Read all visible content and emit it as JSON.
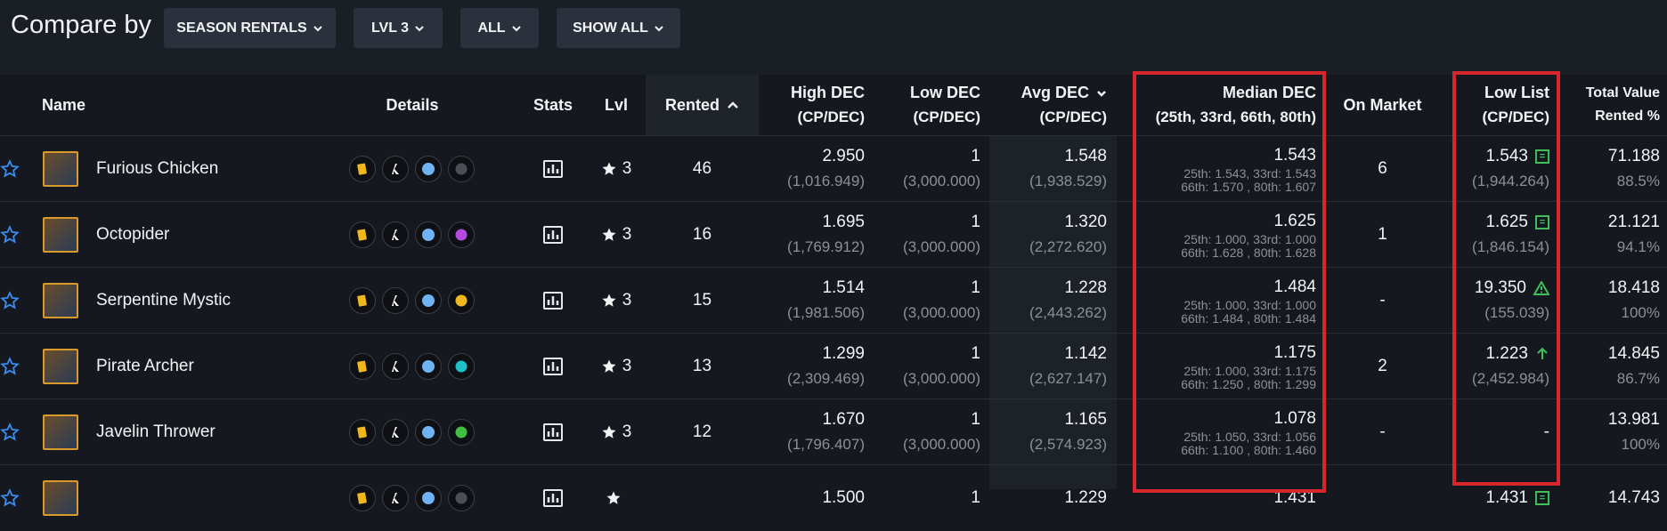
{
  "header": {
    "title": "Compare by",
    "filters": [
      "SEASON RENTALS",
      "LVL 3",
      "ALL",
      "SHOW ALL"
    ]
  },
  "columns": {
    "name": "Name",
    "details": "Details",
    "stats": "Stats",
    "lvl": "Lvl",
    "rented": "Rented",
    "high": [
      "High DEC",
      "(CP/DEC)"
    ],
    "low": [
      "Low DEC",
      "(CP/DEC)"
    ],
    "avg": [
      "Avg DEC",
      "(CP/DEC)"
    ],
    "median": [
      "Median DEC",
      "(25th, 33rd, 66th, 80th)"
    ],
    "on_market": "On Market",
    "low_list": [
      "Low List",
      "(CP/DEC)"
    ],
    "total": [
      "Total Value",
      "Rented %"
    ]
  },
  "rows": [
    {
      "name": "Furious Chicken",
      "lvl": "3",
      "rented": "46",
      "high": "2.950",
      "high_cp": "(1,016.949)",
      "low": "1",
      "low_cp": "(3,000.000)",
      "avg": "1.548",
      "avg_cp": "(1,938.529)",
      "median": "1.543",
      "median_l1": "25th: 1.543, 33rd: 1.543",
      "median_l2": "66th: 1.570 , 80th: 1.607",
      "on_market": "6",
      "low_list": "1.543",
      "low_list_cp": "(1,944.264)",
      "low_list_icon": "equal-icon",
      "total": "71.188",
      "pct": "88.5%",
      "element_color": "#4a4f58"
    },
    {
      "name": "Octopider",
      "lvl": "3",
      "rented": "16",
      "high": "1.695",
      "high_cp": "(1,769.912)",
      "low": "1",
      "low_cp": "(3,000.000)",
      "avg": "1.320",
      "avg_cp": "(2,272.620)",
      "median": "1.625",
      "median_l1": "25th: 1.000, 33rd: 1.000",
      "median_l2": "66th: 1.628 , 80th: 1.628",
      "on_market": "1",
      "low_list": "1.625",
      "low_list_cp": "(1,846.154)",
      "low_list_icon": "equal-icon",
      "total": "21.121",
      "pct": "94.1%",
      "element_color": "#b44be0"
    },
    {
      "name": "Serpentine Mystic",
      "lvl": "3",
      "rented": "15",
      "high": "1.514",
      "high_cp": "(1,981.506)",
      "low": "1",
      "low_cp": "(3,000.000)",
      "avg": "1.228",
      "avg_cp": "(2,443.262)",
      "median": "1.484",
      "median_l1": "25th: 1.000, 33rd: 1.000",
      "median_l2": "66th: 1.484 , 80th: 1.484",
      "on_market": "-",
      "low_list": "19.350",
      "low_list_cp": "(155.039)",
      "low_list_icon": "warning-icon",
      "total": "18.418",
      "pct": "100%",
      "element_color": "#f0b81c"
    },
    {
      "name": "Pirate Archer",
      "lvl": "3",
      "rented": "13",
      "high": "1.299",
      "high_cp": "(2,309.469)",
      "low": "1",
      "low_cp": "(3,000.000)",
      "avg": "1.142",
      "avg_cp": "(2,627.147)",
      "median": "1.175",
      "median_l1": "25th: 1.000, 33rd: 1.175",
      "median_l2": "66th: 1.250 , 80th: 1.299",
      "on_market": "2",
      "low_list": "1.223",
      "low_list_cp": "(2,452.984)",
      "low_list_icon": "arrow-up-icon",
      "total": "14.845",
      "pct": "86.7%",
      "element_color": "#1ec0c9"
    },
    {
      "name": "Javelin Thrower",
      "lvl": "3",
      "rented": "12",
      "high": "1.670",
      "high_cp": "(1,796.407)",
      "low": "1",
      "low_cp": "(3,000.000)",
      "avg": "1.165",
      "avg_cp": "(2,574.923)",
      "median": "1.078",
      "median_l1": "25th: 1.050, 33rd: 1.056",
      "median_l2": "66th: 1.100 , 80th: 1.460",
      "on_market": "-",
      "low_list": "-",
      "low_list_cp": "",
      "low_list_icon": "",
      "total": "13.981",
      "pct": "100%",
      "element_color": "#3fbf3f"
    },
    {
      "name": "",
      "lvl": "",
      "rented": "",
      "high": "1.500",
      "high_cp": "",
      "low": "1",
      "low_cp": "",
      "avg": "1.229",
      "avg_cp": "",
      "median": "1.431",
      "median_l1": "",
      "median_l2": "",
      "on_market": "",
      "low_list": "1.431",
      "low_list_cp": "",
      "low_list_icon": "equal-icon",
      "total": "14.743",
      "pct": "",
      "element_color": "#4a4f58"
    }
  ]
}
